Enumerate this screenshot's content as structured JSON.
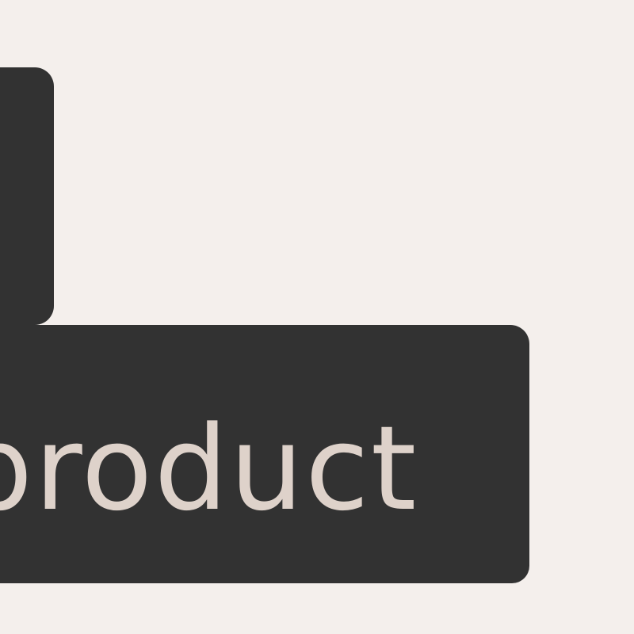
{
  "tag": {
    "label": "product"
  },
  "colors": {
    "background": "#f4efec",
    "surface": "#323232",
    "label_text": "#ded2ca"
  }
}
